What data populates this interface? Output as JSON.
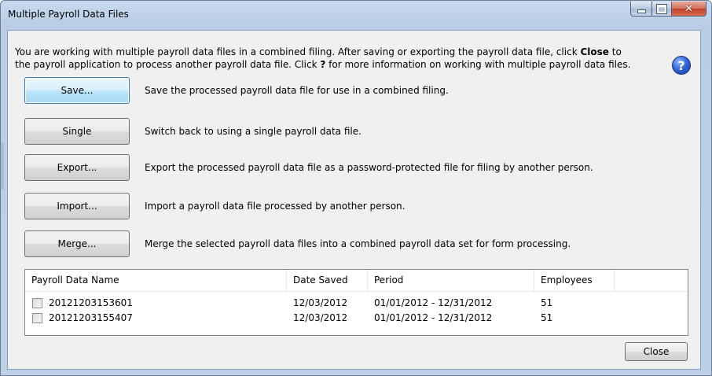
{
  "window": {
    "title": "Multiple Payroll Data Files"
  },
  "intro": {
    "line1_before": "You are working with multiple payroll data files in a combined filing. After saving or exporting the payroll data file, click ",
    "line1_bold": "Close",
    "line1_after": " to",
    "line2_before": "the payroll application to process another payroll data file. Click ",
    "line2_bold": "?",
    "line2_after": " for more information on working with multiple payroll data files."
  },
  "help_icon": "?",
  "actions": [
    {
      "label": "Save...",
      "desc": "Save the processed payroll data file for use in a combined filing."
    },
    {
      "label": "Single",
      "desc": "Switch back to using a single payroll data file."
    },
    {
      "label": "Export...",
      "desc": "Export the processed payroll data file as a password-protected file for filing by another person."
    },
    {
      "label": "Import...",
      "desc": "Import a payroll data file processed by another person."
    },
    {
      "label": "Merge...",
      "desc": "Merge the selected payroll data files into a combined payroll data set for form processing."
    }
  ],
  "table": {
    "headers": [
      "Payroll Data Name",
      "Date Saved",
      "Period",
      "Employees",
      ""
    ],
    "rows": [
      {
        "name": "20121203153601",
        "date": "12/03/2012",
        "period": "01/01/2012 - 12/31/2012",
        "employees": "51",
        "checked": false
      },
      {
        "name": "20121203155407",
        "date": "12/03/2012",
        "period": "01/01/2012 - 12/31/2012",
        "employees": "51",
        "checked": false
      }
    ]
  },
  "footer": {
    "close_label": "Close"
  }
}
